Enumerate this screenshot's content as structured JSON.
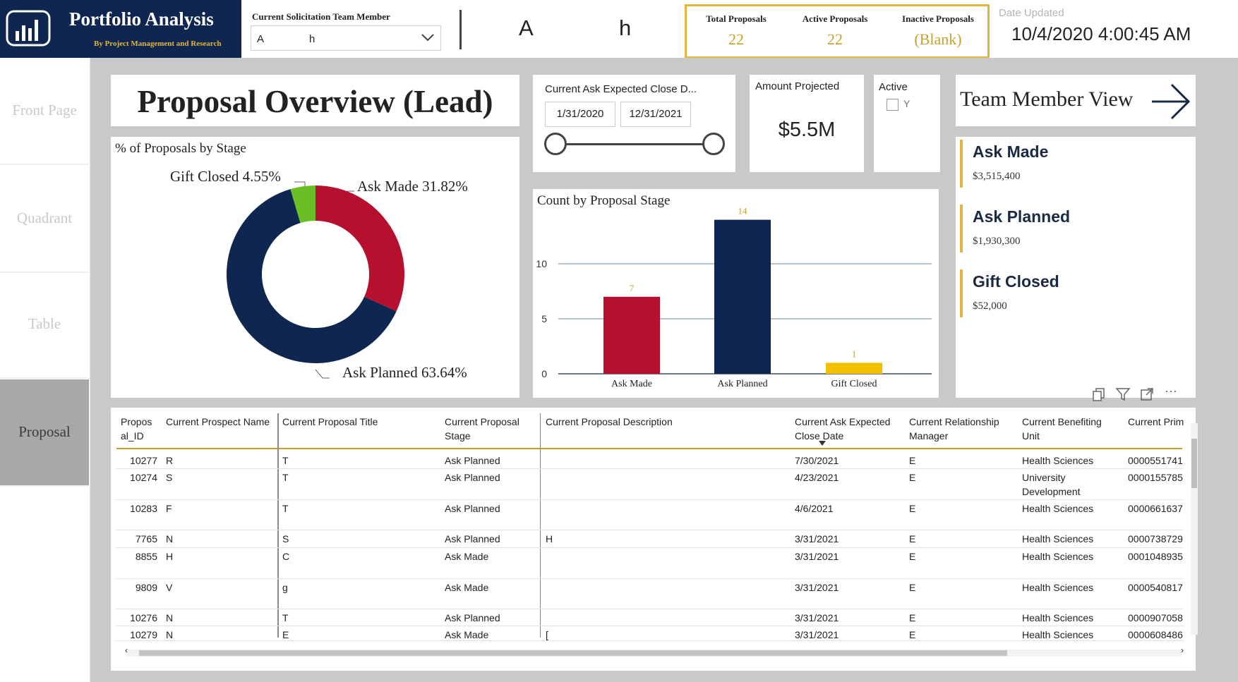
{
  "header": {
    "app_title": "Portfolio Analysis",
    "app_subtitle": "By Project Management and Research",
    "member_label": "Current Solicitation Team Member",
    "member_value_part1": "A",
    "member_value_part2": "h",
    "member_display_a": "A",
    "member_display_h": "h",
    "kpis": [
      {
        "label": "Total Proposals",
        "value": "22"
      },
      {
        "label": "Active Proposals",
        "value": "22"
      },
      {
        "label": "Inactive Proposals",
        "value": "(Blank)"
      }
    ],
    "date_label": "Date Updated",
    "date_value": "10/4/2020 4:00:45 AM"
  },
  "nav": {
    "items": [
      {
        "label": "Front Page",
        "active": false
      },
      {
        "label": "Quadrant",
        "active": false
      },
      {
        "label": "Table",
        "active": false
      },
      {
        "label": "Proposal",
        "active": true
      }
    ]
  },
  "page_title": "Proposal Overview (Lead)",
  "date_filter": {
    "label": "Current Ask Expected Close D...",
    "start": "1/31/2020",
    "end": "12/31/2021"
  },
  "amount": {
    "label": "Amount Projected",
    "value": "$5.5M"
  },
  "active_filter": {
    "label": "Active",
    "option": "Y"
  },
  "team_view": {
    "label": "Team Member View"
  },
  "stage_cards": [
    {
      "title": "Ask Made",
      "amount": "$3,515,400"
    },
    {
      "title": "Ask Planned",
      "amount": "$1,930,300"
    },
    {
      "title": "Gift Closed",
      "amount": "$52,000"
    }
  ],
  "donut": {
    "title": "% of Proposals by Stage",
    "labels": [
      "Ask Made 31.82%",
      "Ask Planned 63.64%",
      "Gift Closed 4.55%"
    ]
  },
  "bar": {
    "title": "Count by Proposal Stage"
  },
  "chart_data": [
    {
      "type": "pie",
      "title": "% of Proposals by Stage",
      "categories": [
        "Ask Made",
        "Ask Planned",
        "Gift Closed"
      ],
      "values": [
        31.82,
        63.64,
        4.55
      ],
      "colors": [
        "#b7102e",
        "#0e2650",
        "#6bbf24"
      ]
    },
    {
      "type": "bar",
      "title": "Count by Proposal Stage",
      "categories": [
        "Ask Made",
        "Ask Planned",
        "Gift Closed"
      ],
      "values": [
        7,
        14,
        1
      ],
      "colors": [
        "#b7102e",
        "#0e2650",
        "#f2c200"
      ],
      "yticks": [
        "0",
        "5",
        "10"
      ],
      "ylim": [
        0,
        15
      ],
      "grid": true
    }
  ],
  "table": {
    "columns": [
      "Propos al_ID",
      "Current Prospect Name",
      "Current Proposal Title",
      "Current Proposal Stage",
      "Current Proposal Description",
      "Current Ask Expected Close Date",
      "Current Relationship Manager",
      "Current Benefiting Unit",
      "Current Prim"
    ],
    "rows": [
      {
        "id": "10277",
        "name": "R",
        "title": "T",
        "stage": "Ask Planned",
        "desc": "",
        "close": "7/30/2021",
        "rm": "E",
        "unit": "Health Sciences",
        "prim": "0000551741"
      },
      {
        "id": "10274",
        "name": "S",
        "title": "T",
        "stage": "Ask Planned",
        "desc": "",
        "close": "4/23/2021",
        "rm": "E",
        "unit": "University Development",
        "prim": "0000155785"
      },
      {
        "id": "10283",
        "name": "F",
        "title": "T",
        "stage": "Ask Planned",
        "desc": "",
        "close": "4/6/2021",
        "rm": "E",
        "unit": "Health Sciences",
        "prim": "0000661637"
      },
      {
        "id": "7765",
        "name": "N",
        "title": "S",
        "stage": "Ask Planned",
        "desc": "H",
        "close": "3/31/2021",
        "rm": "E",
        "unit": "Health Sciences",
        "prim": "0000738729"
      },
      {
        "id": "8855",
        "name": "H",
        "title": "C",
        "stage": "Ask Made",
        "desc": "",
        "close": "3/31/2021",
        "rm": "E",
        "unit": "Health Sciences",
        "prim": "0001048935"
      },
      {
        "id": "9809",
        "name": "V",
        "title": "g",
        "stage": "Ask Made",
        "desc": "",
        "close": "3/31/2021",
        "rm": "E",
        "unit": "Health Sciences",
        "prim": "0000540817"
      },
      {
        "id": "10276",
        "name": "N",
        "title": "T",
        "stage": "Ask Planned",
        "desc": "",
        "close": "3/31/2021",
        "rm": "E",
        "unit": "Health Sciences",
        "prim": "0000907058"
      },
      {
        "id": "10279",
        "name": "N",
        "title": "E",
        "stage": "Ask Made",
        "desc": "[",
        "close": "3/31/2021",
        "rm": "E",
        "unit": "Health Sciences",
        "prim": "0000608486"
      }
    ]
  }
}
